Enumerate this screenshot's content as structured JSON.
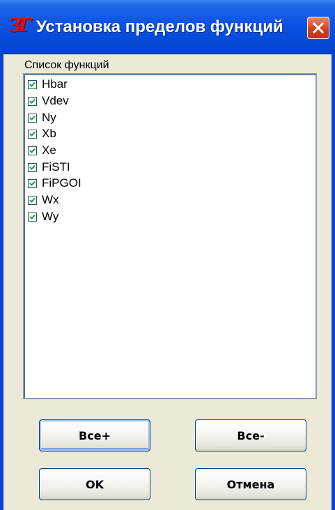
{
  "window": {
    "title": "Установка пределов функций",
    "logo_text": "ЗГ"
  },
  "list": {
    "label": "Список функций",
    "items": [
      {
        "label": "Hbar",
        "checked": true
      },
      {
        "label": "Vdev",
        "checked": true
      },
      {
        "label": "Ny",
        "checked": true
      },
      {
        "label": "Xb",
        "checked": true
      },
      {
        "label": "Xe",
        "checked": true
      },
      {
        "label": "FiSTI",
        "checked": true
      },
      {
        "label": "FiPGOI",
        "checked": true
      },
      {
        "label": "Wx",
        "checked": true
      },
      {
        "label": "Wy",
        "checked": true
      }
    ]
  },
  "buttons": {
    "all_plus": "Все+",
    "all_minus": "Все-",
    "ok": "OK",
    "cancel": "Отмена"
  },
  "colors": {
    "titlebar": "#0a52e2",
    "dialog_bg": "#ece9d8",
    "close_button": "#d4401c",
    "logo": "#e01010"
  }
}
